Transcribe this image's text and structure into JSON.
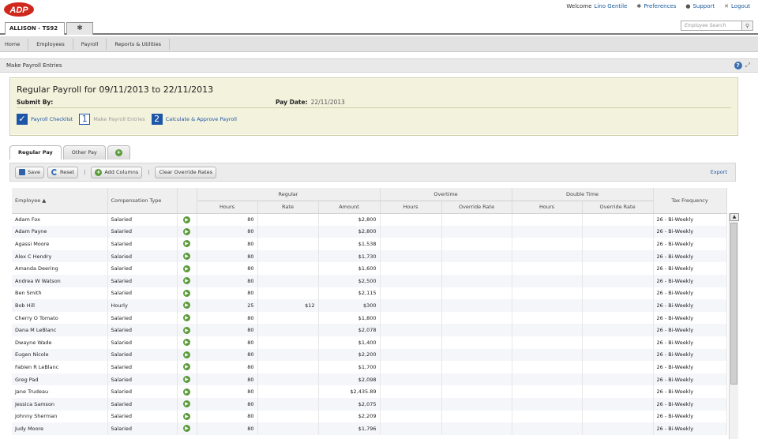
{
  "header": {
    "brand": "ADP",
    "welcome": "Welcome",
    "user": "Lino Gentile",
    "preferences": "Preferences",
    "support": "Support",
    "logout": "Logout",
    "client_tab": "ALLISON - TS92",
    "search_placeholder": "Employee Search"
  },
  "menu": [
    "Home",
    "Employees",
    "Payroll",
    "Reports & Utilities"
  ],
  "page_title": "Make Payroll Entries",
  "summary": {
    "title": "Regular Payroll for 09/11/2013 to 22/11/2013",
    "submit_by_label": "Submit By:",
    "pay_date_label": "Pay Date:",
    "pay_date": "22/11/2013",
    "steps": [
      {
        "marker": "✓",
        "label": "Payroll Checklist"
      },
      {
        "marker": "1",
        "label": "Make Payroll Entries"
      },
      {
        "marker": "2",
        "label": "Calculate & Approve Payroll"
      }
    ]
  },
  "tabs": [
    "Regular Pay",
    "Other Pay",
    "+"
  ],
  "toolbar": {
    "save": "Save",
    "reset": "Reset",
    "add_columns": "Add Columns",
    "clear": "Clear Override Rates",
    "export": "Export"
  },
  "grid": {
    "headers": {
      "employee": "Employee ▲",
      "comp_type": "Compensation Type",
      "regular": "Regular",
      "overtime": "Overtime",
      "double_time": "Double Time",
      "tax_frequency": "Tax Frequency",
      "hours": "Hours",
      "rate": "Rate",
      "amount": "Amount",
      "override_rate": "Override Rate"
    },
    "rows": [
      {
        "name": "Adam Fox",
        "type": "Salaried",
        "hours": "80",
        "rate": "",
        "amount": "$2,800",
        "tax": "26 - Bi-Weekly"
      },
      {
        "name": "Adam Payne",
        "type": "Salaried",
        "hours": "80",
        "rate": "",
        "amount": "$2,800",
        "tax": "26 - Bi-Weekly"
      },
      {
        "name": "Agassi Moore",
        "type": "Salaried",
        "hours": "80",
        "rate": "",
        "amount": "$1,538",
        "tax": "26 - Bi-Weekly"
      },
      {
        "name": "Alex C Hendry",
        "type": "Salaried",
        "hours": "80",
        "rate": "",
        "amount": "$1,730",
        "tax": "26 - Bi-Weekly"
      },
      {
        "name": "Amanda Deering",
        "type": "Salaried",
        "hours": "80",
        "rate": "",
        "amount": "$1,600",
        "tax": "26 - Bi-Weekly"
      },
      {
        "name": "Andrea W Watson",
        "type": "Salaried",
        "hours": "80",
        "rate": "",
        "amount": "$2,500",
        "tax": "26 - Bi-Weekly"
      },
      {
        "name": "Ben Smith",
        "type": "Salaried",
        "hours": "80",
        "rate": "",
        "amount": "$2,115",
        "tax": "26 - Bi-Weekly"
      },
      {
        "name": "Bob Hill",
        "type": "Hourly",
        "hours": "25",
        "rate": "$12",
        "amount": "$300",
        "tax": "26 - Bi-Weekly"
      },
      {
        "name": "Cherry O Tomato",
        "type": "Salaried",
        "hours": "80",
        "rate": "",
        "amount": "$1,800",
        "tax": "26 - Bi-Weekly"
      },
      {
        "name": "Dana M LeBlanc",
        "type": "Salaried",
        "hours": "80",
        "rate": "",
        "amount": "$2,078",
        "tax": "26 - Bi-Weekly"
      },
      {
        "name": "Dwayne Wade",
        "type": "Salaried",
        "hours": "80",
        "rate": "",
        "amount": "$1,400",
        "tax": "26 - Bi-Weekly"
      },
      {
        "name": "Eugen Nicole",
        "type": "Salaried",
        "hours": "80",
        "rate": "",
        "amount": "$2,200",
        "tax": "26 - Bi-Weekly"
      },
      {
        "name": "Fabien R LeBlanc",
        "type": "Salaried",
        "hours": "80",
        "rate": "",
        "amount": "$1,700",
        "tax": "26 - Bi-Weekly"
      },
      {
        "name": "Greg Pad",
        "type": "Salaried",
        "hours": "80",
        "rate": "",
        "amount": "$2,098",
        "tax": "26 - Bi-Weekly"
      },
      {
        "name": "Jane Trudeau",
        "type": "Salaried",
        "hours": "80",
        "rate": "",
        "amount": "$2,435.89",
        "tax": "26 - Bi-Weekly"
      },
      {
        "name": "Jessica Samson",
        "type": "Salaried",
        "hours": "80",
        "rate": "",
        "amount": "$2,075",
        "tax": "26 - Bi-Weekly"
      },
      {
        "name": "Johnny Sherman",
        "type": "Salaried",
        "hours": "80",
        "rate": "",
        "amount": "$2,209",
        "tax": "26 - Bi-Weekly"
      },
      {
        "name": "Judy Moore",
        "type": "Salaried",
        "hours": "80",
        "rate": "",
        "amount": "$1,796",
        "tax": "26 - Bi-Weekly"
      }
    ]
  },
  "colors": {
    "brand": "#d0271d",
    "link": "#1d55a8",
    "summary_bg": "#f3f2dc"
  }
}
